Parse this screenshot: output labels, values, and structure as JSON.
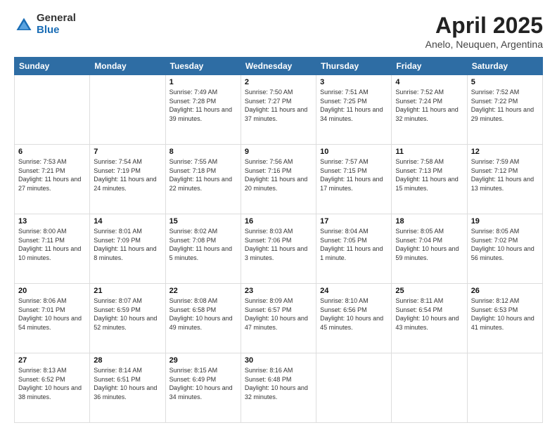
{
  "header": {
    "logo_general": "General",
    "logo_blue": "Blue",
    "title": "April 2025",
    "subtitle": "Anelo, Neuquen, Argentina"
  },
  "weekdays": [
    "Sunday",
    "Monday",
    "Tuesday",
    "Wednesday",
    "Thursday",
    "Friday",
    "Saturday"
  ],
  "weeks": [
    [
      {
        "day": "",
        "sunrise": "",
        "sunset": "",
        "daylight": ""
      },
      {
        "day": "",
        "sunrise": "",
        "sunset": "",
        "daylight": ""
      },
      {
        "day": "1",
        "sunrise": "Sunrise: 7:49 AM",
        "sunset": "Sunset: 7:28 PM",
        "daylight": "Daylight: 11 hours and 39 minutes."
      },
      {
        "day": "2",
        "sunrise": "Sunrise: 7:50 AM",
        "sunset": "Sunset: 7:27 PM",
        "daylight": "Daylight: 11 hours and 37 minutes."
      },
      {
        "day": "3",
        "sunrise": "Sunrise: 7:51 AM",
        "sunset": "Sunset: 7:25 PM",
        "daylight": "Daylight: 11 hours and 34 minutes."
      },
      {
        "day": "4",
        "sunrise": "Sunrise: 7:52 AM",
        "sunset": "Sunset: 7:24 PM",
        "daylight": "Daylight: 11 hours and 32 minutes."
      },
      {
        "day": "5",
        "sunrise": "Sunrise: 7:52 AM",
        "sunset": "Sunset: 7:22 PM",
        "daylight": "Daylight: 11 hours and 29 minutes."
      }
    ],
    [
      {
        "day": "6",
        "sunrise": "Sunrise: 7:53 AM",
        "sunset": "Sunset: 7:21 PM",
        "daylight": "Daylight: 11 hours and 27 minutes."
      },
      {
        "day": "7",
        "sunrise": "Sunrise: 7:54 AM",
        "sunset": "Sunset: 7:19 PM",
        "daylight": "Daylight: 11 hours and 24 minutes."
      },
      {
        "day": "8",
        "sunrise": "Sunrise: 7:55 AM",
        "sunset": "Sunset: 7:18 PM",
        "daylight": "Daylight: 11 hours and 22 minutes."
      },
      {
        "day": "9",
        "sunrise": "Sunrise: 7:56 AM",
        "sunset": "Sunset: 7:16 PM",
        "daylight": "Daylight: 11 hours and 20 minutes."
      },
      {
        "day": "10",
        "sunrise": "Sunrise: 7:57 AM",
        "sunset": "Sunset: 7:15 PM",
        "daylight": "Daylight: 11 hours and 17 minutes."
      },
      {
        "day": "11",
        "sunrise": "Sunrise: 7:58 AM",
        "sunset": "Sunset: 7:13 PM",
        "daylight": "Daylight: 11 hours and 15 minutes."
      },
      {
        "day": "12",
        "sunrise": "Sunrise: 7:59 AM",
        "sunset": "Sunset: 7:12 PM",
        "daylight": "Daylight: 11 hours and 13 minutes."
      }
    ],
    [
      {
        "day": "13",
        "sunrise": "Sunrise: 8:00 AM",
        "sunset": "Sunset: 7:11 PM",
        "daylight": "Daylight: 11 hours and 10 minutes."
      },
      {
        "day": "14",
        "sunrise": "Sunrise: 8:01 AM",
        "sunset": "Sunset: 7:09 PM",
        "daylight": "Daylight: 11 hours and 8 minutes."
      },
      {
        "day": "15",
        "sunrise": "Sunrise: 8:02 AM",
        "sunset": "Sunset: 7:08 PM",
        "daylight": "Daylight: 11 hours and 5 minutes."
      },
      {
        "day": "16",
        "sunrise": "Sunrise: 8:03 AM",
        "sunset": "Sunset: 7:06 PM",
        "daylight": "Daylight: 11 hours and 3 minutes."
      },
      {
        "day": "17",
        "sunrise": "Sunrise: 8:04 AM",
        "sunset": "Sunset: 7:05 PM",
        "daylight": "Daylight: 11 hours and 1 minute."
      },
      {
        "day": "18",
        "sunrise": "Sunrise: 8:05 AM",
        "sunset": "Sunset: 7:04 PM",
        "daylight": "Daylight: 10 hours and 59 minutes."
      },
      {
        "day": "19",
        "sunrise": "Sunrise: 8:05 AM",
        "sunset": "Sunset: 7:02 PM",
        "daylight": "Daylight: 10 hours and 56 minutes."
      }
    ],
    [
      {
        "day": "20",
        "sunrise": "Sunrise: 8:06 AM",
        "sunset": "Sunset: 7:01 PM",
        "daylight": "Daylight: 10 hours and 54 minutes."
      },
      {
        "day": "21",
        "sunrise": "Sunrise: 8:07 AM",
        "sunset": "Sunset: 6:59 PM",
        "daylight": "Daylight: 10 hours and 52 minutes."
      },
      {
        "day": "22",
        "sunrise": "Sunrise: 8:08 AM",
        "sunset": "Sunset: 6:58 PM",
        "daylight": "Daylight: 10 hours and 49 minutes."
      },
      {
        "day": "23",
        "sunrise": "Sunrise: 8:09 AM",
        "sunset": "Sunset: 6:57 PM",
        "daylight": "Daylight: 10 hours and 47 minutes."
      },
      {
        "day": "24",
        "sunrise": "Sunrise: 8:10 AM",
        "sunset": "Sunset: 6:56 PM",
        "daylight": "Daylight: 10 hours and 45 minutes."
      },
      {
        "day": "25",
        "sunrise": "Sunrise: 8:11 AM",
        "sunset": "Sunset: 6:54 PM",
        "daylight": "Daylight: 10 hours and 43 minutes."
      },
      {
        "day": "26",
        "sunrise": "Sunrise: 8:12 AM",
        "sunset": "Sunset: 6:53 PM",
        "daylight": "Daylight: 10 hours and 41 minutes."
      }
    ],
    [
      {
        "day": "27",
        "sunrise": "Sunrise: 8:13 AM",
        "sunset": "Sunset: 6:52 PM",
        "daylight": "Daylight: 10 hours and 38 minutes."
      },
      {
        "day": "28",
        "sunrise": "Sunrise: 8:14 AM",
        "sunset": "Sunset: 6:51 PM",
        "daylight": "Daylight: 10 hours and 36 minutes."
      },
      {
        "day": "29",
        "sunrise": "Sunrise: 8:15 AM",
        "sunset": "Sunset: 6:49 PM",
        "daylight": "Daylight: 10 hours and 34 minutes."
      },
      {
        "day": "30",
        "sunrise": "Sunrise: 8:16 AM",
        "sunset": "Sunset: 6:48 PM",
        "daylight": "Daylight: 10 hours and 32 minutes."
      },
      {
        "day": "",
        "sunrise": "",
        "sunset": "",
        "daylight": ""
      },
      {
        "day": "",
        "sunrise": "",
        "sunset": "",
        "daylight": ""
      },
      {
        "day": "",
        "sunrise": "",
        "sunset": "",
        "daylight": ""
      }
    ]
  ]
}
